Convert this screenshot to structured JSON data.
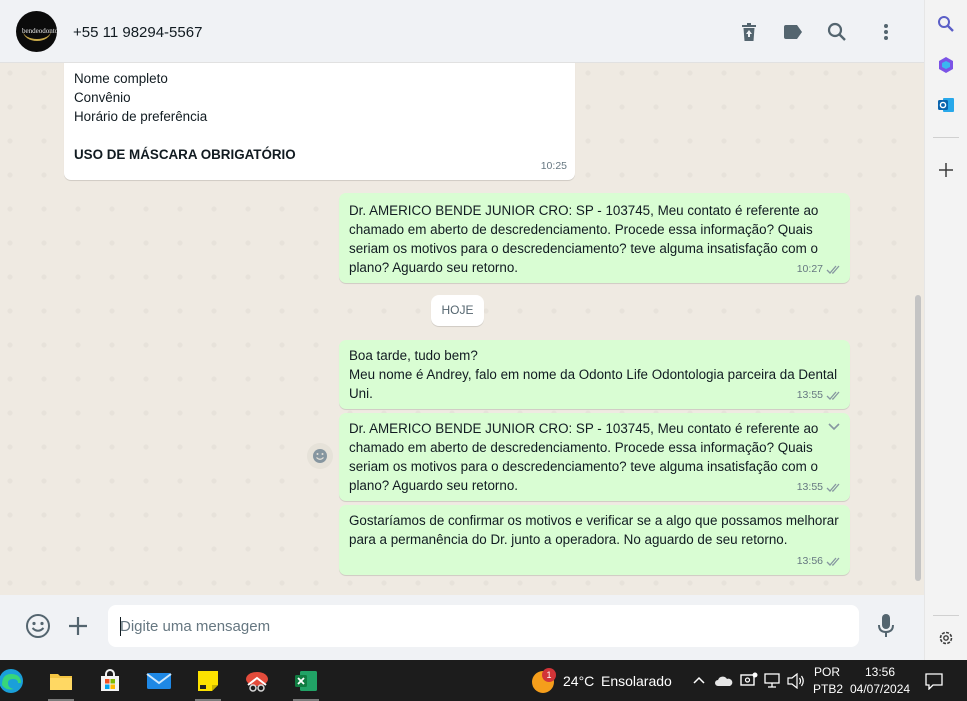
{
  "header": {
    "contact_name": "+55 11 98294-5567",
    "avatar_logo_text": "bendeodonto"
  },
  "messages": [
    {
      "direction": "in",
      "lines": [
        "Nome completo",
        "Convênio",
        "Horário de preferência"
      ],
      "bold_line": "USO DE MÁSCARA OBRIGATÓRIO",
      "time": "10:25"
    },
    {
      "direction": "out",
      "text": "Dr. AMERICO BENDE JUNIOR CRO: SP - 103745, Meu contato é referente ao chamado em aberto de descredenciamento. Procede essa informação? Quais seriam os motivos para o descredenciamento? teve alguma insatisfação com o plano? Aguardo seu retorno.",
      "time": "10:27"
    },
    {
      "direction": "out",
      "text": "Boa tarde, tudo bem?\nMeu nome é Andrey, falo em nome da Odonto Life Odontologia parceira da Dental Uni.",
      "time": "13:55"
    },
    {
      "direction": "out",
      "text": "Dr. AMERICO BENDE JUNIOR CRO: SP - 103745, Meu contato é referente ao chamado em aberto de descredenciamento. Procede essa informação? Quais seriam os motivos para o descredenciamento? teve alguma insatisfação com o plano? Aguardo seu retorno.",
      "time": "13:55"
    },
    {
      "direction": "out",
      "text": "Gostaríamos de confirmar os motivos e verificar se a algo que possamos melhorar para a permanência do Dr. junto a operadora. No aguardo de seu retorno.",
      "time": "13:56"
    }
  ],
  "date_divider": "HOJE",
  "composer": {
    "placeholder": "Digite uma mensagem"
  },
  "taskbar": {
    "weather_badge": "1",
    "weather_temp": "24°C",
    "weather_desc": "Ensolarado",
    "lang_line1": "POR",
    "lang_line2": "PTB2",
    "clock_time": "13:56",
    "clock_date": "04/07/2024"
  },
  "colors": {
    "outgoing_bubble": "#d9fdd3",
    "incoming_bubble": "#ffffff",
    "chat_bg": "#efeae2",
    "tick_read": "#8696a0"
  }
}
